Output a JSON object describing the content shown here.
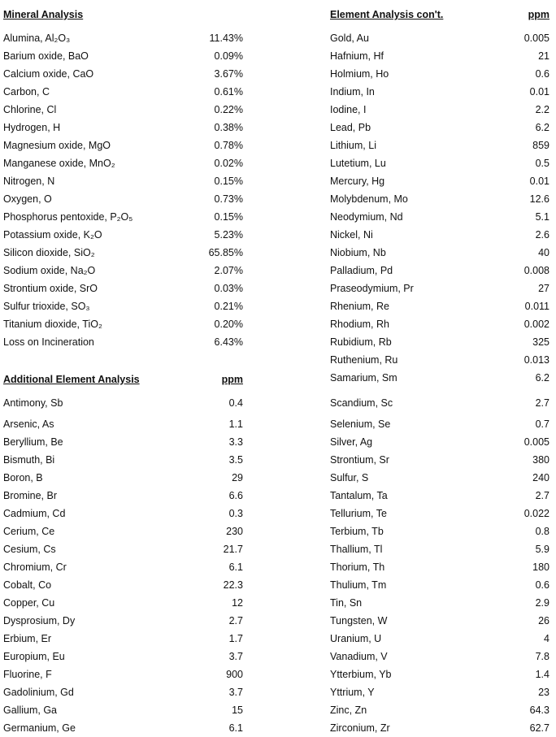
{
  "mineral": {
    "title": "Mineral Analysis",
    "rows": [
      {
        "name": "Alumina, Al₂O₃",
        "value": "11.43%"
      },
      {
        "name": "Barium oxide, BaO",
        "value": "0.09%"
      },
      {
        "name": "Calcium oxide, CaO",
        "value": "3.67%"
      },
      {
        "name": "Carbon, C",
        "value": "0.61%"
      },
      {
        "name": "Chlorine, Cl",
        "value": "0.22%"
      },
      {
        "name": "Hydrogen, H",
        "value": "0.38%"
      },
      {
        "name": "Magnesium oxide, MgO",
        "value": "0.78%"
      },
      {
        "name": "Manganese oxide, MnO₂",
        "value": "0.02%"
      },
      {
        "name": "Nitrogen, N",
        "value": "0.15%"
      },
      {
        "name": "Oxygen, O",
        "value": "0.73%"
      },
      {
        "name": "Phosphorus pentoxide, P₂O₅",
        "value": "0.15%"
      },
      {
        "name": "Potassium oxide, K₂O",
        "value": "5.23%"
      },
      {
        "name": "Silicon dioxide, SiO₂",
        "value": "65.85%"
      },
      {
        "name": "Sodium oxide, Na₂O",
        "value": "2.07%"
      },
      {
        "name": "Strontium oxide, SrO",
        "value": "0.03%"
      },
      {
        "name": "Sulfur trioxide, SO₃",
        "value": "0.21%"
      },
      {
        "name": "Titanium dioxide, TiO₂",
        "value": "0.20%"
      },
      {
        "name": "Loss on Incineration",
        "value": "6.43%"
      }
    ]
  },
  "additional": {
    "title": "Additional Element Analysis",
    "unit": "ppm",
    "rows": [
      {
        "name": "Antimony, Sb",
        "value": "0.4"
      },
      {
        "name": "Arsenic, As",
        "value": "1.1"
      },
      {
        "name": "Beryllium, Be",
        "value": "3.3"
      },
      {
        "name": "Bismuth, Bi",
        "value": "3.5"
      },
      {
        "name": "Boron, B",
        "value": "29"
      },
      {
        "name": "Bromine, Br",
        "value": "6.6"
      },
      {
        "name": "Cadmium, Cd",
        "value": "0.3"
      },
      {
        "name": "Cerium, Ce",
        "value": "230"
      },
      {
        "name": "Cesium, Cs",
        "value": "21.7"
      },
      {
        "name": "Chromium, Cr",
        "value": "6.1"
      },
      {
        "name": "Cobalt, Co",
        "value": "22.3"
      },
      {
        "name": "Copper, Cu",
        "value": "12"
      },
      {
        "name": "Dysprosium, Dy",
        "value": "2.7"
      },
      {
        "name": "Erbium, Er",
        "value": "1.7"
      },
      {
        "name": "Europium, Eu",
        "value": "3.7"
      },
      {
        "name": "Fluorine, F",
        "value": "900"
      },
      {
        "name": "Gadolinium, Gd",
        "value": "3.7"
      },
      {
        "name": "Gallium, Ga",
        "value": "15"
      },
      {
        "name": "Germanium, Ge",
        "value": "6.1"
      }
    ]
  },
  "continued": {
    "title": "Element Analysis con't.",
    "unit": "ppm",
    "rows": [
      {
        "name": "Gold, Au",
        "value": "0.005"
      },
      {
        "name": "Hafnium, Hf",
        "value": "21"
      },
      {
        "name": "Holmium, Ho",
        "value": "0.6"
      },
      {
        "name": "Indium, In",
        "value": "0.01"
      },
      {
        "name": "Iodine, I",
        "value": "2.2"
      },
      {
        "name": "Lead, Pb",
        "value": "6.2"
      },
      {
        "name": "Lithium, Li",
        "value": "859"
      },
      {
        "name": "Lutetium, Lu",
        "value": "0.5"
      },
      {
        "name": "Mercury, Hg",
        "value": "0.01"
      },
      {
        "name": "Molybdenum, Mo",
        "value": "12.6"
      },
      {
        "name": "Neodymium, Nd",
        "value": "5.1"
      },
      {
        "name": "Nickel, Ni",
        "value": "2.6"
      },
      {
        "name": "Niobium, Nb",
        "value": "40"
      },
      {
        "name": "Palladium, Pd",
        "value": "0.008"
      },
      {
        "name": "Praseodymium, Pr",
        "value": "27"
      },
      {
        "name": "Rhenium, Re",
        "value": "0.011"
      },
      {
        "name": "Rhodium, Rh",
        "value": "0.002"
      },
      {
        "name": "Rubidium, Rb",
        "value": "325"
      },
      {
        "name": "Ruthenium, Ru",
        "value": "0.013"
      },
      {
        "name": "Samarium, Sm",
        "value": "6.2"
      },
      {
        "name": "Scandium, Sc",
        "value": "2.7"
      },
      {
        "name": "Selenium, Se",
        "value": "0.7"
      },
      {
        "name": "Silver, Ag",
        "value": "0.005"
      },
      {
        "name": "Strontium, Sr",
        "value": "380"
      },
      {
        "name": "Sulfur, S",
        "value": "240"
      },
      {
        "name": "Tantalum, Ta",
        "value": "2.7"
      },
      {
        "name": "Tellurium, Te",
        "value": "0.022"
      },
      {
        "name": "Terbium, Tb",
        "value": "0.8"
      },
      {
        "name": "Thallium, Tl",
        "value": "5.9"
      },
      {
        "name": "Thorium, Th",
        "value": "180"
      },
      {
        "name": "Thulium, Tm",
        "value": "0.6"
      },
      {
        "name": "Tin, Sn",
        "value": "2.9"
      },
      {
        "name": "Tungsten, W",
        "value": "26"
      },
      {
        "name": "Uranium, U",
        "value": "4"
      },
      {
        "name": "Vanadium, V",
        "value": "7.8"
      },
      {
        "name": "Ytterbium, Yb",
        "value": "1.4"
      },
      {
        "name": "Yttrium, Y",
        "value": "23"
      },
      {
        "name": "Zinc, Zn",
        "value": "64.3"
      },
      {
        "name": "Zirconium, Zr",
        "value": "62.7"
      }
    ]
  }
}
